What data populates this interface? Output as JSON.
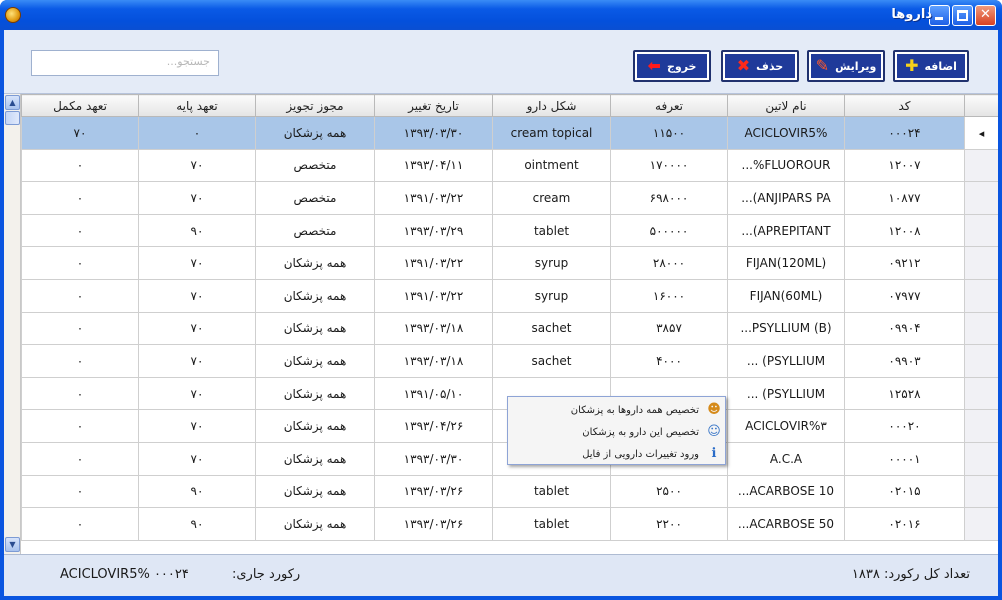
{
  "window": {
    "title": "داروها"
  },
  "toolbar": {
    "search_placeholder": "جستجو...",
    "buttons": [
      {
        "name": "add-button",
        "label": "اضافه",
        "icon": "plus-icon",
        "glyph": "✚",
        "color": "#f7d21a"
      },
      {
        "name": "edit-button",
        "label": "ویرایش",
        "icon": "edit-icon",
        "glyph": "✎",
        "color": "#ff5a2a"
      },
      {
        "name": "delete-button",
        "label": "حذف",
        "icon": "delete-x-icon",
        "glyph": "✖",
        "color": "#ff2a1a"
      },
      {
        "name": "exit-button",
        "label": "خروج",
        "icon": "arrow-left-icon",
        "glyph": "⬅",
        "color": "#ff1a1a"
      }
    ]
  },
  "grid": {
    "columns": [
      "کد",
      "نام لاتین",
      "تعرفه",
      "شکل دارو",
      "تاریخ تغییر",
      "مجوز تجویز",
      "تعهد پایه",
      "تعهد مکمل"
    ],
    "rows": [
      {
        "code": "۰۰۰۲۴",
        "latin": "ACICLOVIR5%",
        "tariff": "۱۱۵۰۰",
        "form": "cream topical",
        "date": "۱۳۹۳/۰۳/۳۰",
        "permit": "همه پزشکان",
        "base": "۰",
        "supp": "۷۰",
        "selected": true
      },
      {
        "code": "۱۲۰۰۷",
        "latin": "FLUOROUR%...",
        "tariff": "۱۷۰۰۰۰",
        "form": "ointment",
        "date": "۱۳۹۳/۰۴/۱۱",
        "permit": "متخصص",
        "base": "۷۰",
        "supp": "۰"
      },
      {
        "code": "۱۰۸۷۷",
        "latin": "ANJIPARS PA)...",
        "tariff": "۶۹۸۰۰۰",
        "form": "cream",
        "date": "۱۳۹۱/۰۳/۲۲",
        "permit": "متخصص",
        "base": "۷۰",
        "supp": "۰"
      },
      {
        "code": "۱۲۰۰۸",
        "latin": "APREPITANT)...",
        "tariff": "۵۰۰۰۰۰",
        "form": "tablet",
        "date": "۱۳۹۳/۰۳/۲۹",
        "permit": "متخصص",
        "base": "۹۰",
        "supp": "۰"
      },
      {
        "code": "۰۹۲۱۲",
        "latin": "FIJAN(120ML)",
        "tariff": "۲۸۰۰۰",
        "form": "syrup",
        "date": "۱۳۹۱/۰۳/۲۲",
        "permit": "همه پزشکان",
        "base": "۷۰",
        "supp": "۰"
      },
      {
        "code": "۰۷۹۷۷",
        "latin": "FIJAN(60ML)",
        "tariff": "۱۶۰۰۰",
        "form": "syrup",
        "date": "۱۳۹۱/۰۳/۲۲",
        "permit": "همه پزشکان",
        "base": "۷۰",
        "supp": "۰"
      },
      {
        "code": "۰۹۹۰۴",
        "latin": "PSYLLIUM (B)...",
        "tariff": "۳۸۵۷",
        "form": "sachet",
        "date": "۱۳۹۳/۰۳/۱۸",
        "permit": "همه پزشکان",
        "base": "۷۰",
        "supp": "۰"
      },
      {
        "code": "۰۹۹۰۳",
        "latin": "PSYLLIUM) ...",
        "tariff": "۴۰۰۰",
        "form": "sachet",
        "date": "۱۳۹۳/۰۳/۱۸",
        "permit": "همه پزشکان",
        "base": "۷۰",
        "supp": "۰"
      },
      {
        "code": "۱۲۵۲۸",
        "latin": "PSYLLIUM) ...",
        "tariff": "",
        "form": "",
        "date": "۱۳۹۱/۰۵/۱۰",
        "permit": "همه پزشکان",
        "base": "۷۰",
        "supp": "۰"
      },
      {
        "code": "۰۰۰۲۰",
        "latin": "ACICLOVIR%۳",
        "tariff": "",
        "form": "",
        "date": "۱۳۹۳/۰۴/۲۶",
        "permit": "همه پزشکان",
        "base": "۷۰",
        "supp": "۰"
      },
      {
        "code": "۰۰۰۰۱",
        "latin": "A.C.A",
        "tariff": "",
        "form": "",
        "date": "۱۳۹۳/۰۳/۳۰",
        "permit": "همه پزشکان",
        "base": "۷۰",
        "supp": "۰"
      },
      {
        "code": "۰۲۰۱۵",
        "latin": "ACARBOSE 10...",
        "tariff": "۲۵۰۰",
        "form": "tablet",
        "date": "۱۳۹۳/۰۳/۲۶",
        "permit": "همه پزشکان",
        "base": "۹۰",
        "supp": "۰"
      },
      {
        "code": "۰۲۰۱۶",
        "latin": "ACARBOSE 50...",
        "tariff": "۲۲۰۰",
        "form": "tablet",
        "date": "۱۳۹۳/۰۳/۲۶",
        "permit": "همه پزشکان",
        "base": "۹۰",
        "supp": "۰"
      }
    ]
  },
  "context_menu": {
    "items": [
      {
        "name": "menu-assign-all-drugs",
        "label": "تخصیص همه داروها به پزشکان",
        "icon": "user-icon",
        "glyph": "☻"
      },
      {
        "name": "menu-assign-this-drug",
        "label": "تخصیص این دارو به پزشکان",
        "icon": "users-icon",
        "glyph": "☺"
      },
      {
        "name": "menu-import-changes",
        "label": "ورود تغییرات دارویی از فایل",
        "icon": "info-icon",
        "glyph": "ℹ"
      }
    ]
  },
  "status": {
    "total_label": "تعداد کل رکورد:",
    "total_value": "۱۸۳۸",
    "current_label": "رکورد جاری:",
    "current_value": "ACICLOVIR5% ۰۰۰۲۴"
  }
}
